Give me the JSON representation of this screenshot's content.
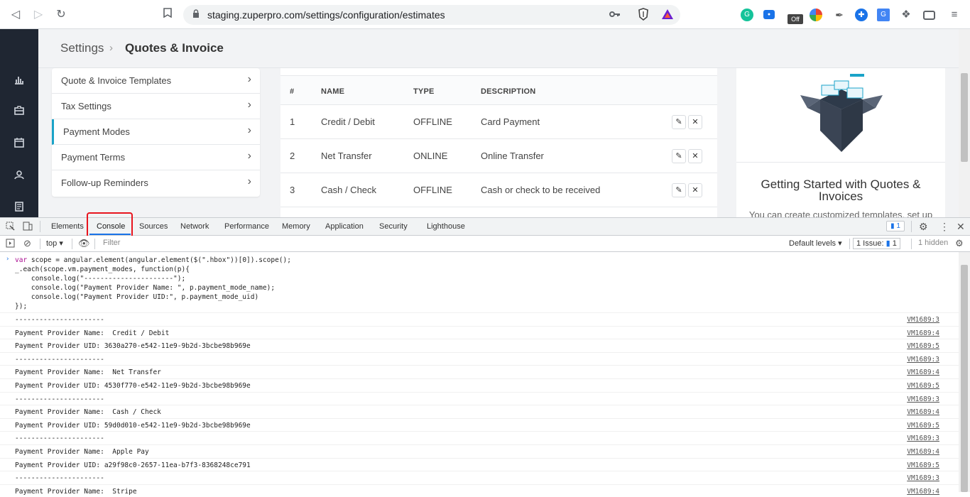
{
  "browser": {
    "url": "staging.zuperpro.com/settings/configuration/estimates",
    "extension_badge": "Off"
  },
  "app": {
    "breadcrumb": {
      "parent": "Settings",
      "separator": "›",
      "current": "Quotes & Invoice"
    },
    "menu": [
      {
        "label": "Quote & Invoice Templates",
        "active": false
      },
      {
        "label": "Tax Settings",
        "active": false
      },
      {
        "label": "Payment Modes",
        "active": true
      },
      {
        "label": "Payment Terms",
        "active": false
      },
      {
        "label": "Follow-up Reminders",
        "active": false
      }
    ],
    "table": {
      "headers": [
        "#",
        "NAME",
        "TYPE",
        "DESCRIPTION"
      ],
      "rows": [
        {
          "num": "1",
          "name": "Credit / Debit",
          "type": "OFFLINE",
          "description": "Card Payment"
        },
        {
          "num": "2",
          "name": "Net Transfer",
          "type": "ONLINE",
          "description": "Online Transfer"
        },
        {
          "num": "3",
          "name": "Cash / Check",
          "type": "OFFLINE",
          "description": "Cash or check to be received"
        }
      ]
    },
    "side_card": {
      "title": "Getting Started with Quotes & Invoices",
      "subtitle": "You can create customized templates, set up"
    }
  },
  "devtools": {
    "tabs": [
      "Elements",
      "Console",
      "Sources",
      "Network",
      "Performance",
      "Memory",
      "Application",
      "Security",
      "Lighthouse"
    ],
    "active_tab": "Console",
    "messages_badge": "1",
    "toolbar": {
      "context": "top",
      "filter_placeholder": "Filter",
      "levels": "Default levels",
      "issues_label": "1 Issue:",
      "issues_count": "1",
      "hidden": "1 hidden"
    },
    "code_lines": [
      "var scope = angular.element(angular.element($(\".hbox\"))[0]).scope();",
      "_.each(scope.vm.payment_modes, function(p){",
      "    console.log(\"----------------------\");",
      "    console.log(\"Payment Provider Name: \", p.payment_mode_name);",
      "    console.log(\"Payment Provider UID:\", p.payment_mode_uid)",
      "});"
    ],
    "logs": [
      {
        "msg": "----------------------",
        "src": "VM1689:3"
      },
      {
        "msg": "Payment Provider Name:  Credit / Debit",
        "src": "VM1689:4"
      },
      {
        "msg": "Payment Provider UID: 3630a270-e542-11e9-9b2d-3bcbe98b969e",
        "src": "VM1689:5"
      },
      {
        "msg": "----------------------",
        "src": "VM1689:3"
      },
      {
        "msg": "Payment Provider Name:  Net Transfer",
        "src": "VM1689:4"
      },
      {
        "msg": "Payment Provider UID: 4530f770-e542-11e9-9b2d-3bcbe98b969e",
        "src": "VM1689:5"
      },
      {
        "msg": "----------------------",
        "src": "VM1689:3"
      },
      {
        "msg": "Payment Provider Name:  Cash / Check",
        "src": "VM1689:4"
      },
      {
        "msg": "Payment Provider UID: 59d0d010-e542-11e9-9b2d-3bcbe98b969e",
        "src": "VM1689:5"
      },
      {
        "msg": "----------------------",
        "src": "VM1689:3"
      },
      {
        "msg": "Payment Provider Name:  Apple Pay",
        "src": "VM1689:4"
      },
      {
        "msg": "Payment Provider UID: a29f98c0-2657-11ea-b7f3-8368248ce791",
        "src": "VM1689:5"
      },
      {
        "msg": "----------------------",
        "src": "VM1689:3"
      },
      {
        "msg": "Payment Provider Name:  Stripe",
        "src": "VM1689:4"
      }
    ]
  },
  "icons": {
    "back": "arrow-left-icon",
    "forward": "arrow-right-icon",
    "reload": "reload-icon",
    "bookmark": "bookmark-icon",
    "lock": "lock-icon",
    "key": "key-icon",
    "edit": "pencil-icon",
    "delete": "close-icon"
  },
  "colors": {
    "accent": "#1aa3c8",
    "sidebar": "#1f2632",
    "highlight_box": "#e8141e",
    "devtools_active": "#1a73e8"
  }
}
